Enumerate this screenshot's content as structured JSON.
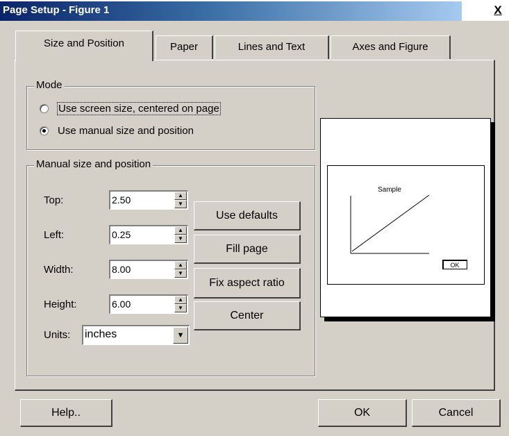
{
  "window": {
    "title": "Page Setup - Figure 1",
    "close_glyph": "X"
  },
  "tabs": [
    {
      "label": "Size and Position",
      "active": true
    },
    {
      "label": "Paper",
      "active": false
    },
    {
      "label": "Lines and Text",
      "active": false
    },
    {
      "label": "Axes and Figure",
      "active": false
    }
  ],
  "mode": {
    "legend": "Mode",
    "options": [
      {
        "label": "Use screen size, centered on page",
        "checked": false
      },
      {
        "label": "Use manual size and position",
        "checked": true
      }
    ]
  },
  "manual": {
    "legend": "Manual size and position",
    "fields": [
      {
        "label": "Top:",
        "value": "2.50"
      },
      {
        "label": "Left:",
        "value": "0.25"
      },
      {
        "label": "Width:",
        "value": "8.00"
      },
      {
        "label": "Height:",
        "value": "6.00"
      }
    ],
    "units": {
      "label": "Units:",
      "value": "inches"
    },
    "buttons": {
      "defaults": "Use defaults",
      "fill": "Fill page",
      "aspect": "Fix aspect ratio",
      "center": "Center"
    }
  },
  "preview": {
    "sample_title": "Sample",
    "ok_label": "OK"
  },
  "footer": {
    "help": "Help..",
    "ok": "OK",
    "cancel": "Cancel"
  }
}
